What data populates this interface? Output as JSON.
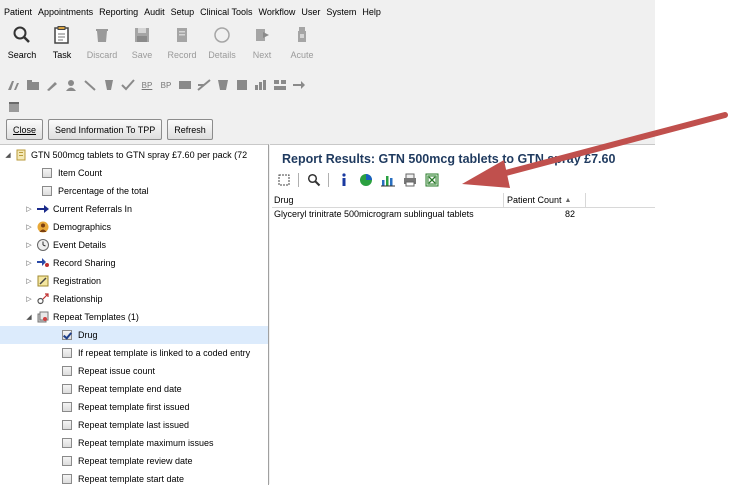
{
  "menu": [
    "Patient",
    "Appointments",
    "Reporting",
    "Audit",
    "Setup",
    "Clinical Tools",
    "Workflow",
    "User",
    "System",
    "Help"
  ],
  "toolbar": [
    {
      "label": "Search",
      "icon": "search-icon",
      "enabled": true
    },
    {
      "label": "Task",
      "icon": "task-icon",
      "enabled": true
    },
    {
      "label": "Discard",
      "icon": "discard-icon",
      "enabled": false
    },
    {
      "label": "Save",
      "icon": "save-icon",
      "enabled": false
    },
    {
      "label": "Record",
      "icon": "record-icon",
      "enabled": false
    },
    {
      "label": "Details",
      "icon": "details-icon",
      "enabled": false
    },
    {
      "label": "Next",
      "icon": "next-icon",
      "enabled": false
    },
    {
      "label": "Acute",
      "icon": "acute-icon",
      "enabled": false
    }
  ],
  "small_toolbar": {
    "bp1": "BP",
    "bp2": "BP"
  },
  "actions": {
    "close": "Close",
    "send": "Send Information To TPP",
    "refresh": "Refresh"
  },
  "tree": {
    "root": "GTN 500mcg tablets to GTN spray £7.60 per pack (72",
    "items": [
      {
        "label": "Item Count",
        "type": "check",
        "checked": false
      },
      {
        "label": "Percentage of the total",
        "type": "check",
        "checked": false
      },
      {
        "label": "Current Referrals In",
        "type": "folder"
      },
      {
        "label": "Demographics",
        "type": "folder"
      },
      {
        "label": "Event Details",
        "type": "folder"
      },
      {
        "label": "Record Sharing",
        "type": "folder"
      },
      {
        "label": "Registration",
        "type": "folder"
      },
      {
        "label": "Relationship",
        "type": "folder"
      },
      {
        "label": "Repeat Templates (1)",
        "type": "folder-open"
      },
      {
        "label": "Drug",
        "type": "check",
        "checked": true
      },
      {
        "label": "If repeat template is linked to a coded entry",
        "type": "check",
        "checked": false
      },
      {
        "label": "Repeat issue count",
        "type": "check",
        "checked": false
      },
      {
        "label": "Repeat template end date",
        "type": "check",
        "checked": false
      },
      {
        "label": "Repeat template first issued",
        "type": "check",
        "checked": false
      },
      {
        "label": "Repeat template last issued",
        "type": "check",
        "checked": false
      },
      {
        "label": "Repeat template maximum issues",
        "type": "check",
        "checked": false
      },
      {
        "label": "Repeat template review date",
        "type": "check",
        "checked": false
      },
      {
        "label": "Repeat template start date",
        "type": "check",
        "checked": false
      }
    ]
  },
  "report": {
    "title": "Report Results: GTN 500mcg tablets to GTN spray £7.60",
    "columns": [
      "Drug",
      "Patient Count"
    ],
    "rows": [
      {
        "drug": "Glyceryl trinitrate 500microgram sublingual tablets",
        "count": "82"
      }
    ]
  },
  "colors": {
    "annotation_arrow": "#c0504d",
    "report_title": "#1f3a5f",
    "selection": "#dcebfc"
  }
}
